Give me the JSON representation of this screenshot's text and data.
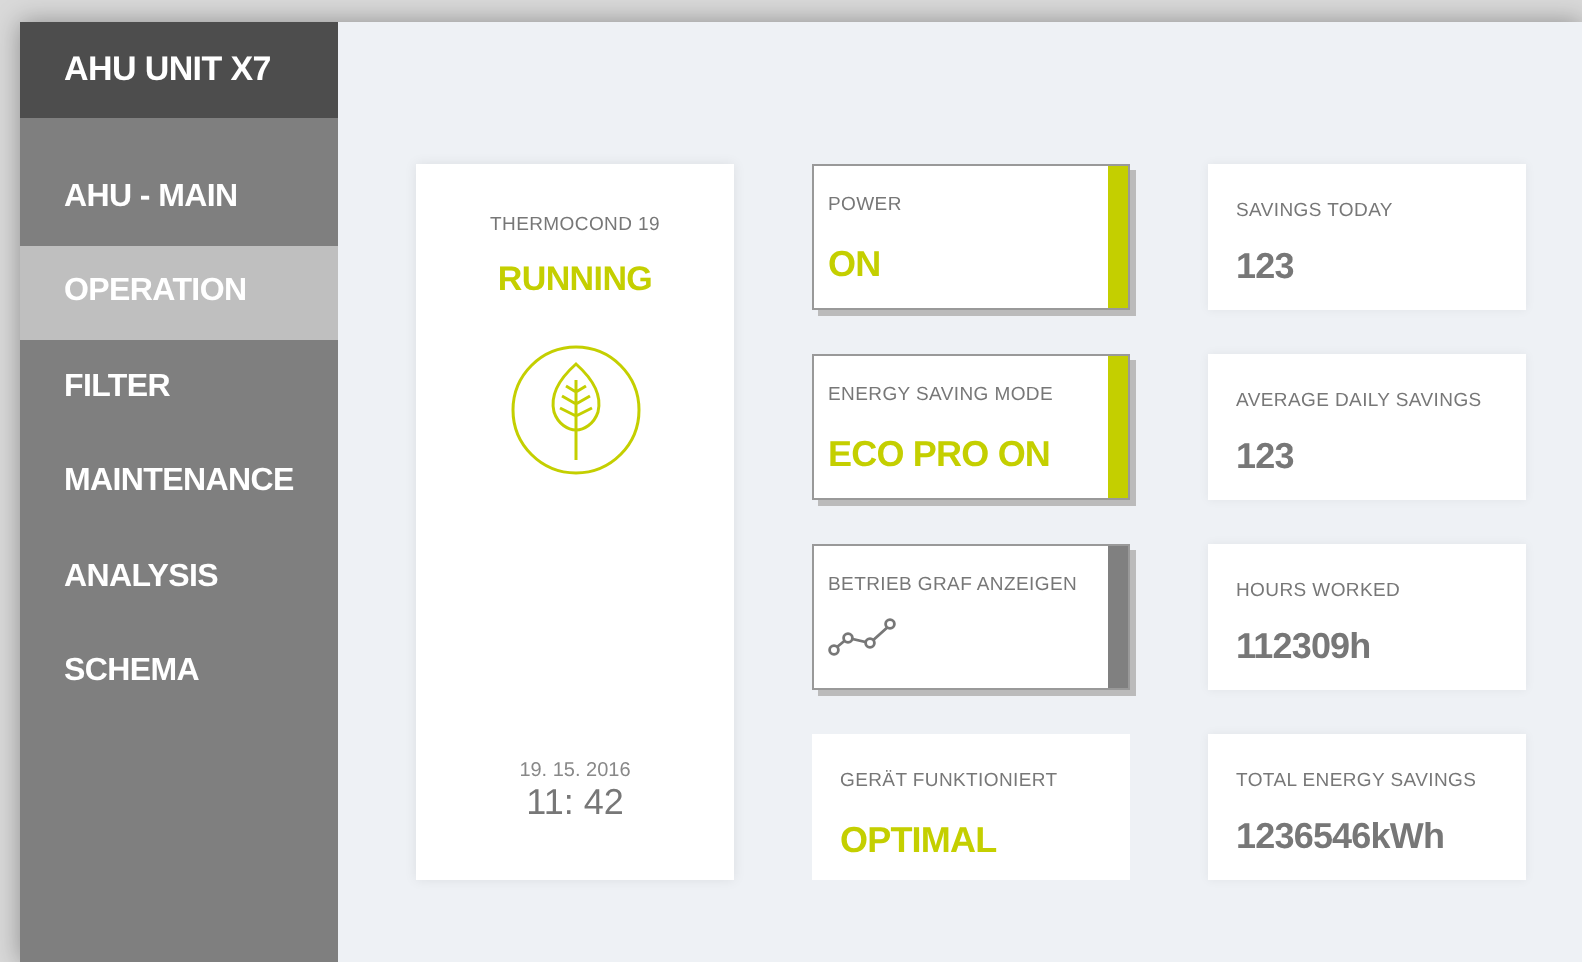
{
  "sidebar": {
    "title": "AHU UNIT X7",
    "items": [
      {
        "label": "AHU - MAIN",
        "selected": false
      },
      {
        "label": "OPERATION",
        "selected": true
      },
      {
        "label": "FILTER",
        "selected": false
      },
      {
        "label": "MAINTENANCE",
        "selected": false
      },
      {
        "label": "ANALYSIS",
        "selected": false
      },
      {
        "label": "SCHEMA",
        "selected": false
      }
    ]
  },
  "device": {
    "name": "THERMOCOND 19",
    "status": "RUNNING",
    "date": "19. 15. 2016",
    "time": "11: 42"
  },
  "controls": [
    {
      "kind": "switch",
      "label": "POWER",
      "value": "ON",
      "on": true
    },
    {
      "kind": "switch",
      "label": "ENERGY SAVING MODE",
      "value": "ECO PRO ON",
      "on": true
    },
    {
      "kind": "graph",
      "label": "BETRIEB GRAF ANZEIGEN"
    },
    {
      "kind": "status",
      "label": "GERÄT FUNKTIONIERT",
      "value": "OPTIMAL"
    }
  ],
  "stats": [
    {
      "label": "SAVINGS TODAY",
      "value": "123"
    },
    {
      "label": "AVERAGE DAILY SAVINGS",
      "value": "123"
    },
    {
      "label": "HOURS WORKED",
      "value": "112309h"
    },
    {
      "label": "TOTAL ENERGY SAVINGS",
      "value": "1236546kWh"
    }
  ]
}
